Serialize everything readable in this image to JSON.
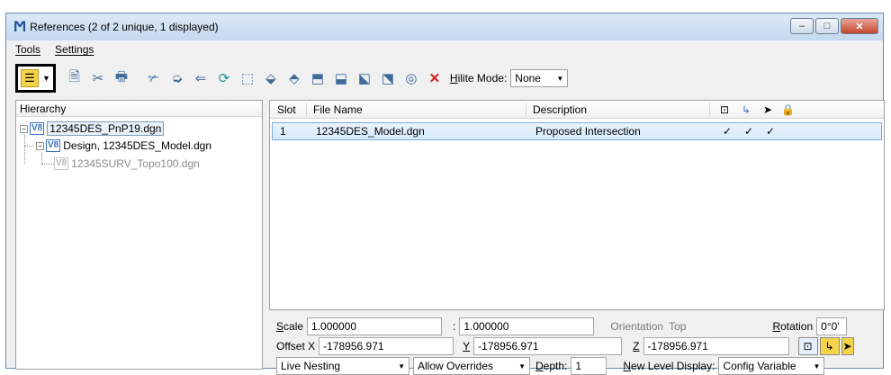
{
  "window": {
    "title": "References (2 of 2 unique, 1 displayed)",
    "controls": {
      "minimize": "–",
      "maximize": "□",
      "close": "✕"
    }
  },
  "menu": {
    "tools": "Tools",
    "settings": "Settings"
  },
  "toolbar": {
    "hilite_label": "Hilite Mode:",
    "hilite_value": "None"
  },
  "hierarchy": {
    "header": "Hierarchy",
    "nodes": [
      {
        "label": "12345DES_PnP19.dgn"
      },
      {
        "label": "Design, 12345DES_Model.dgn"
      },
      {
        "label": "12345SURV_Topo100.dgn"
      }
    ]
  },
  "references": {
    "columns": {
      "slot": "Slot",
      "file": "File Name",
      "desc": "Description"
    },
    "rows": [
      {
        "slot": "1",
        "file": "12345DES_Model.dgn",
        "desc": "Proposed Intersection",
        "c1": "✓",
        "c2": "✓",
        "c3": "✓"
      }
    ]
  },
  "properties": {
    "scale_label": "Scale",
    "scale_a": "1.000000",
    "scale_sep": ":",
    "scale_b": "1.000000",
    "orientation_label": "Orientation",
    "orientation_value": "Top",
    "rotation_label": "Rotation",
    "rotation_value": "0°0'",
    "offset_x_label": "Offset X",
    "offset_x": "-178956.971",
    "y_label": "Y",
    "offset_y": "-178956.971",
    "z_label": "Z",
    "offset_z": "-178956.971",
    "nesting": "Live Nesting",
    "overrides": "Allow Overrides",
    "depth_label": "Depth:",
    "depth": "1",
    "new_level_label": "New Level Display:",
    "new_level_value": "Config Variable"
  }
}
